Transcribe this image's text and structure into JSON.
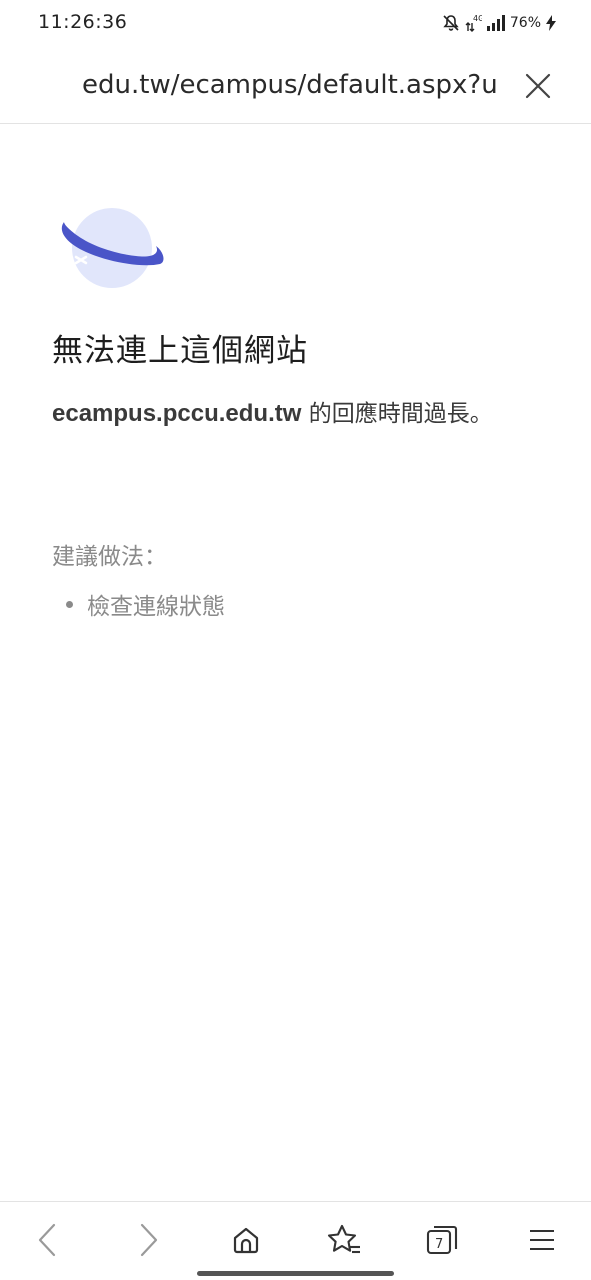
{
  "status_bar": {
    "time": "11:26:36",
    "network": "4G",
    "battery": "76%",
    "icons": [
      "mute-bell-icon",
      "data-arrows-icon",
      "signal-icon",
      "charging-bolt-icon"
    ]
  },
  "url_bar": {
    "url": "edu.tw/ecampus/default.aspx?us",
    "close_icon": "close-icon"
  },
  "error": {
    "icon": "planet-error-icon",
    "title": "無法連上這個網站",
    "host": "ecampus.pccu.edu.tw",
    "message": " 的回應時間過長。",
    "suggestions_label": "建議做法：",
    "suggestions": [
      "檢查連線狀態"
    ]
  },
  "toolbar": {
    "tab_count": "7",
    "icons": [
      "back-arrow-icon",
      "forward-arrow-icon",
      "home-icon",
      "bookmarks-star-icon",
      "tabs-icon",
      "menu-icon"
    ]
  },
  "colors": {
    "planet_light": "#e1e6fb",
    "planet_ring": "#4a55c8",
    "text_primary": "#1e1e1e",
    "text_muted": "#8a8a8a",
    "divider": "#e3e3e3"
  }
}
